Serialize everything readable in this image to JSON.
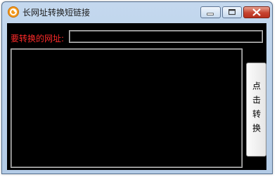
{
  "window": {
    "title": "长网址转换短链接",
    "icon": "orange-app-icon"
  },
  "form": {
    "url_label": "要转换的网址:",
    "url_value": "",
    "output_text": "",
    "convert_button_label": "点击转换"
  },
  "colors": {
    "client_background": "#000000",
    "label_color": "#ff2a2a",
    "titlebar": "#b9cfe8"
  }
}
